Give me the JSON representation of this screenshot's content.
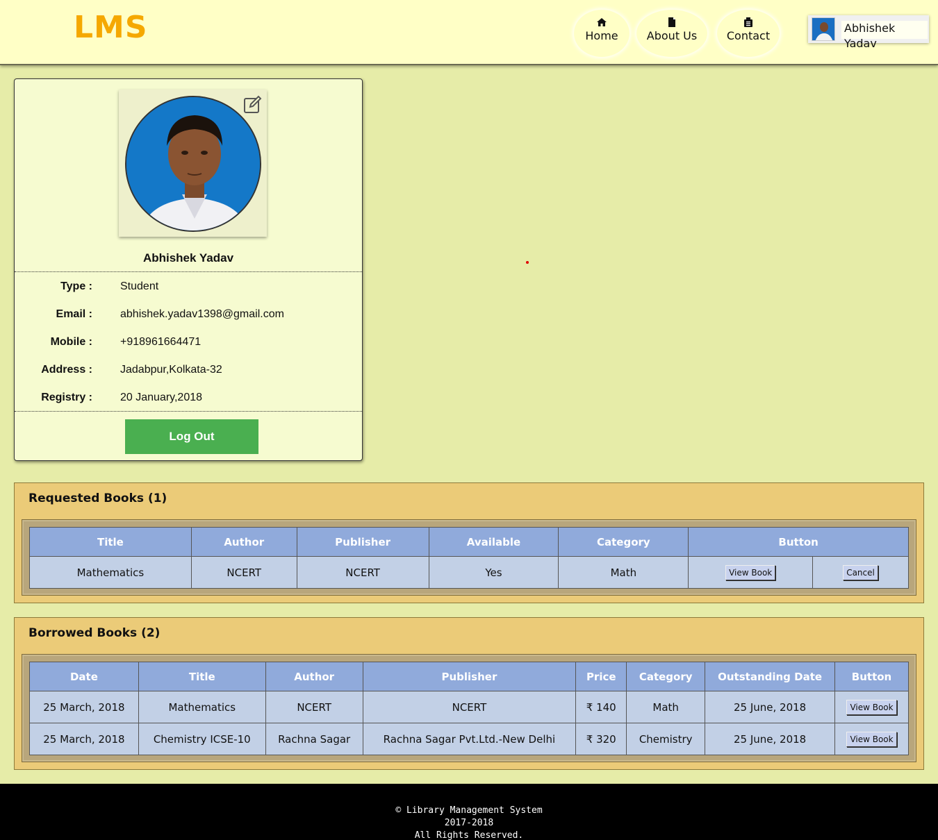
{
  "app": {
    "logo": "LMS"
  },
  "nav": {
    "home": {
      "label": "Home",
      "icon": "home-icon"
    },
    "about": {
      "label": "About Us",
      "icon": "document-icon"
    },
    "contact": {
      "label": "Contact",
      "icon": "fax-icon"
    }
  },
  "user": {
    "name": "Abhishek Yadav"
  },
  "profile": {
    "name": "Abhishek Yadav",
    "fields": [
      {
        "label": "Type :",
        "value": "Student"
      },
      {
        "label": "Email :",
        "value": "abhishek.yadav1398@gmail.com"
      },
      {
        "label": "Mobile :",
        "value": "+918961664471"
      },
      {
        "label": "Address :",
        "value": "Jadabpur,Kolkata-32"
      },
      {
        "label": "Registry :",
        "value": "20 January,2018"
      }
    ],
    "logout_label": "Log Out"
  },
  "requested": {
    "heading": "Requested Books (1)",
    "columns": [
      "Title",
      "Author",
      "Publisher",
      "Available",
      "Category",
      "Button"
    ],
    "rows": [
      {
        "title": "Mathematics",
        "author": "NCERT",
        "publisher": "NCERT",
        "available": "Yes",
        "category": "Math",
        "view_label": "View Book",
        "cancel_label": "Cancel"
      }
    ]
  },
  "borrowed": {
    "heading": "Borrowed Books (2)",
    "columns": [
      "Date",
      "Title",
      "Author",
      "Publisher",
      "Price",
      "Category",
      "Outstanding Date",
      "Button"
    ],
    "rows": [
      {
        "date": "25 March, 2018",
        "title": "Mathematics",
        "author": "NCERT",
        "publisher": "NCERT",
        "price": "₹ 140",
        "category": "Math",
        "outstanding": "25 June, 2018",
        "view_label": "View Book"
      },
      {
        "date": "25 March, 2018",
        "title": "Chemistry ICSE-10",
        "author": "Rachna Sagar",
        "publisher": "Rachna Sagar Pvt.Ltd.-New Delhi",
        "price": "₹ 320",
        "category": "Chemistry",
        "outstanding": "25 June, 2018",
        "view_label": "View Book"
      }
    ]
  },
  "footer": {
    "line1": "© Library Management System",
    "line2": "2017-2018",
    "line3": "All Rights Reserved."
  }
}
